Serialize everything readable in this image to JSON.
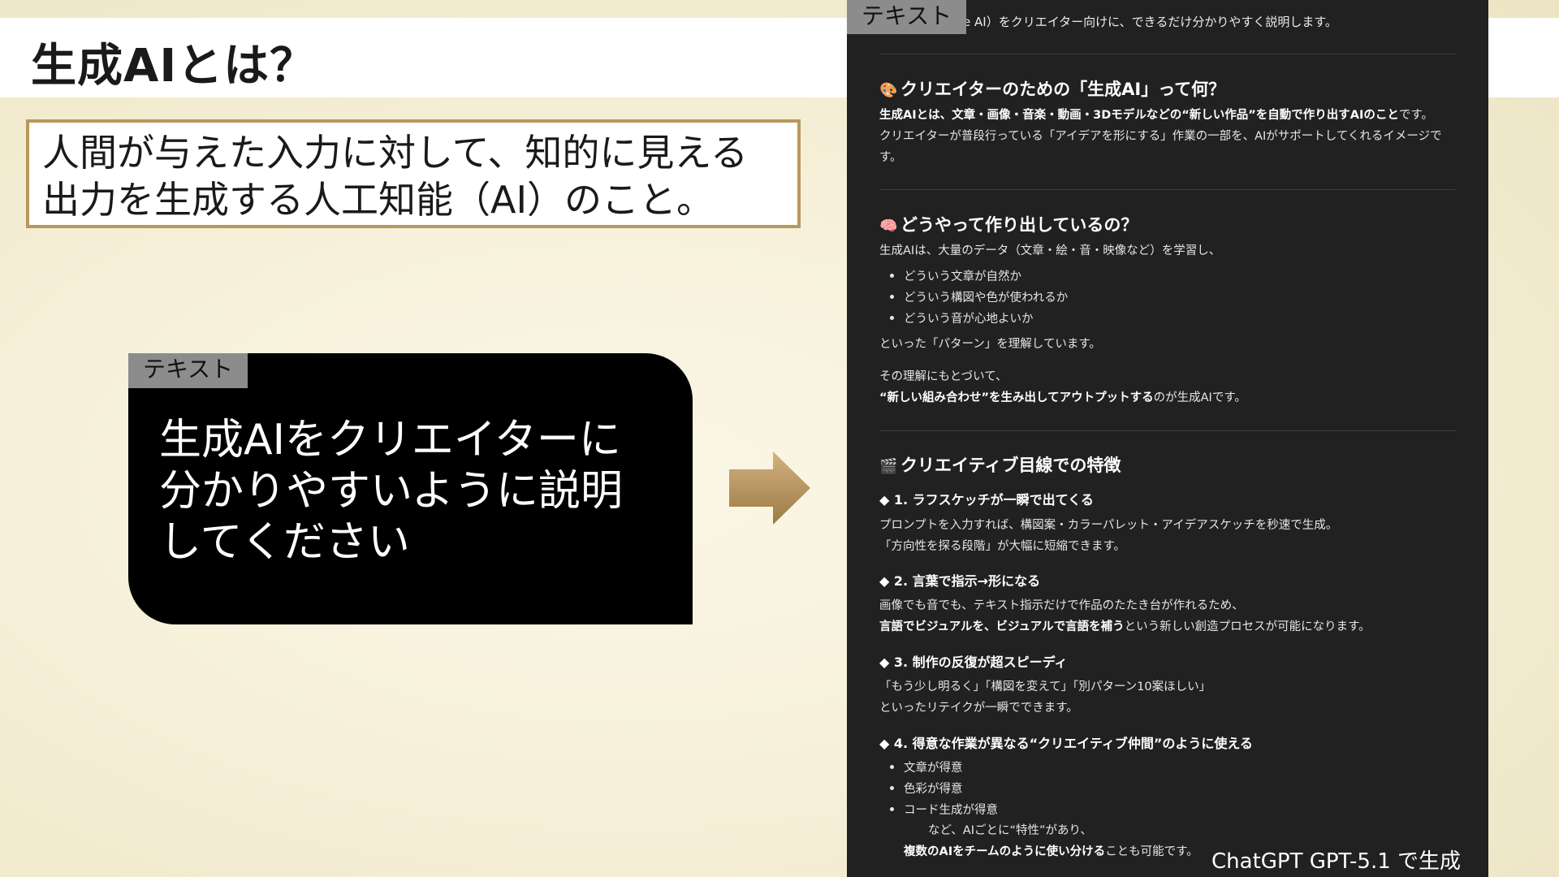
{
  "slide": {
    "title": "生成AIとは？",
    "definition_lines": [
      "人間が与えた入力に対して、知的に見える",
      "出力を生成する人工知能（AI）のこと。"
    ]
  },
  "prompt": {
    "tag": "テキスト",
    "lines": [
      "生成AIをクリエイターに",
      "分かりやすいように説明",
      "してください"
    ]
  },
  "arrow": {
    "icon": "right-arrow-icon",
    "color": "#b89560"
  },
  "response": {
    "tag": "テキスト",
    "intro": "ive AI）をクリエイター向けに、できるだけ分かりやすく説明します。",
    "section1": {
      "icon": "palette-icon",
      "emoji": "🎨",
      "heading": "クリエイターのための「生成AI」って何？",
      "p1_bold": "生成AIとは、文章・画像・音楽・動画・3Dモデルなどの“新しい作品”を自動で作り出すAIのこと",
      "p1_rest": "です。",
      "p2": "クリエイターが普段行っている「アイデアを形にする」作業の一部を、AIがサポートしてくれるイメージで",
      "p2_cont": "す。"
    },
    "section2": {
      "icon": "brain-icon",
      "emoji": "🧠",
      "heading": "どうやって作り出しているの？",
      "p1": "生成AIは、大量のデータ（文章・絵・音・映像など）を学習し、",
      "bullets": [
        "どういう文章が自然か",
        "どういう構図や色が使われるか",
        "どういう音が心地よいか"
      ],
      "p2": "といった「パターン」を理解しています。",
      "p3": "その理解にもとづいて、",
      "p4_bold": "“新しい組み合わせ”を生み出してアウトプットする",
      "p4_rest": "のが生成AIです。"
    },
    "section3": {
      "icon": "clapperboard-icon",
      "emoji": "🎬",
      "heading": "クリエイティブ目線での特徴",
      "f1": {
        "heading": "◆ 1. ラフスケッチが一瞬で出てくる",
        "p1": "プロンプトを入力すれば、構図案・カラーパレット・アイデアスケッチを秒速で生成。",
        "p2": "「方向性を探る段階」が大幅に短縮できます。"
      },
      "f2": {
        "heading": "◆ 2. 言葉で指示→形になる",
        "p1": "画像でも音でも、テキスト指示だけで作品のたたき台が作れるため、",
        "p2_bold": "言語でビジュアルを、ビジュアルで言語を補う",
        "p2_rest": "という新しい創造プロセスが可能になります。"
      },
      "f3": {
        "heading": "◆ 3. 制作の反復が超スピーディ",
        "p1": "「もう少し明るく」「構図を変えて」「別パターン10案ほしい」",
        "p2": "といったリテイクが一瞬でできます。"
      },
      "f4": {
        "heading": "◆ 4. 得意な作業が異なる“クリエイティブ仲間”のように使える",
        "bullets": [
          "文章が得意",
          "色彩が得意",
          "コード生成が得意"
        ],
        "p1": "など、AIごとに“特性”があり、",
        "p2_bold": "複数のAIをチームのように使い分ける",
        "p2_rest": "ことも可能です。"
      }
    }
  },
  "credit": "ChatGPT GPT-5.1 で生成"
}
